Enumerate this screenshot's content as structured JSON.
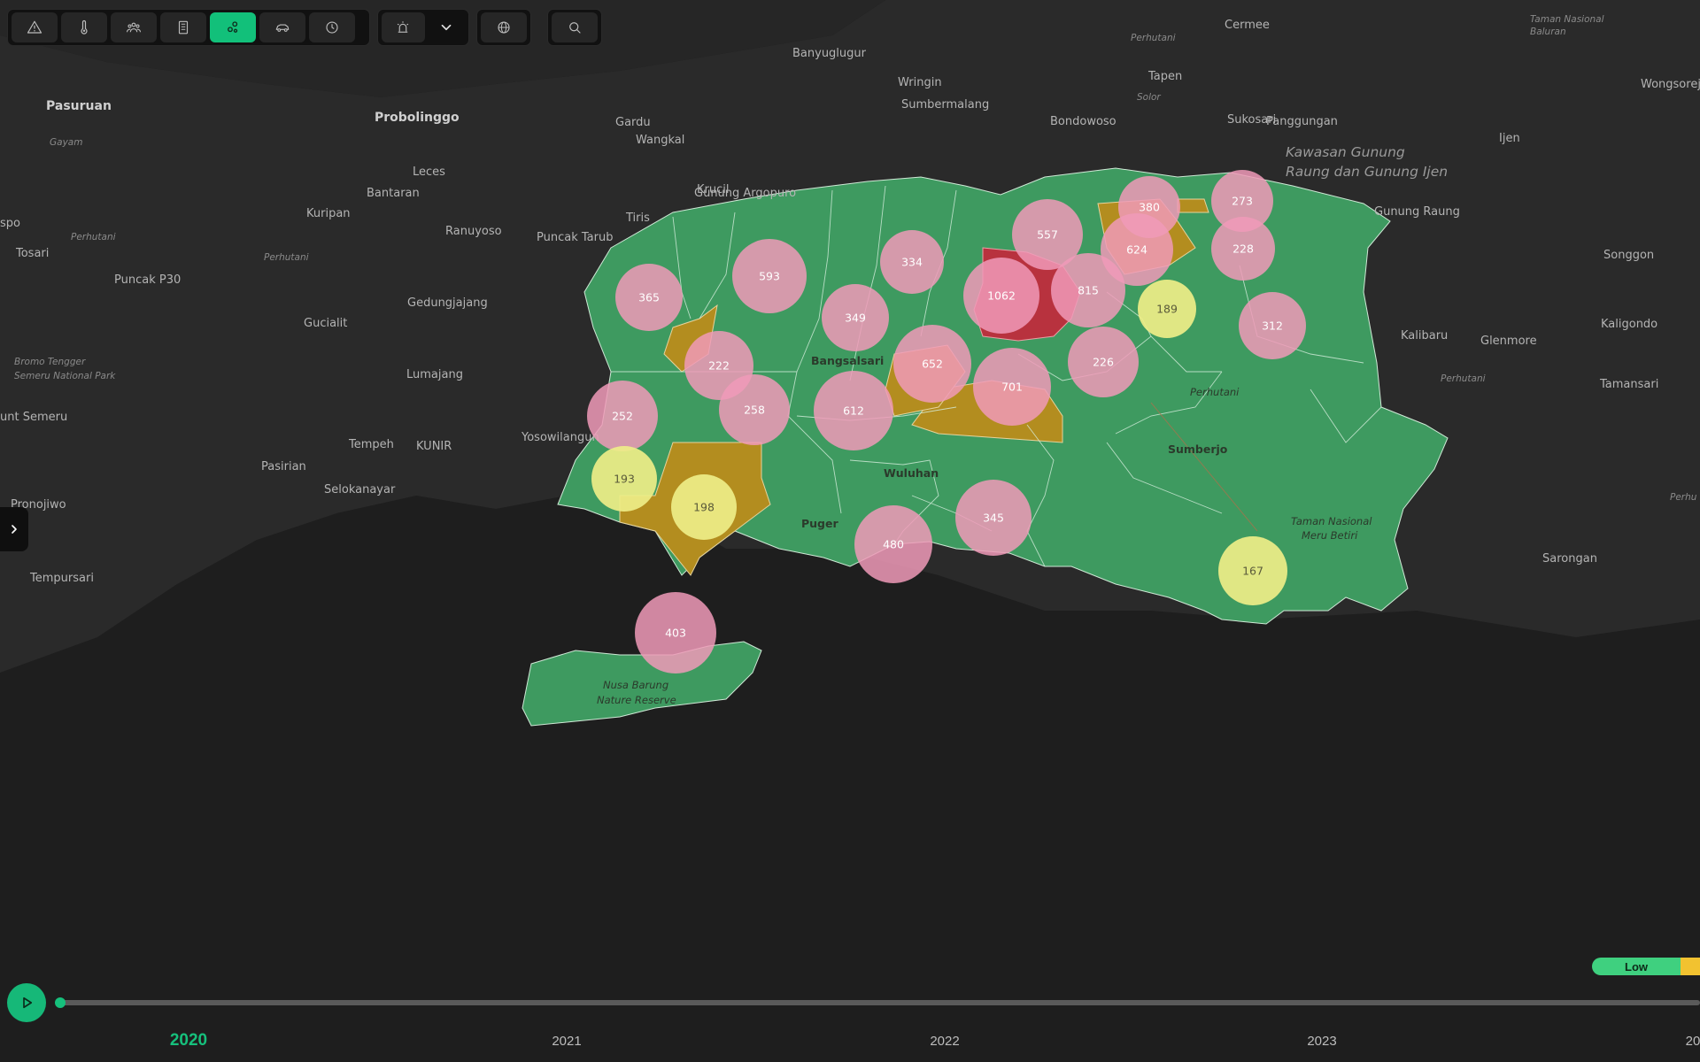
{
  "toolbar": {
    "group1": [
      {
        "icon": "warning-icon",
        "active": false
      },
      {
        "icon": "thermometer-icon",
        "active": false
      },
      {
        "icon": "people-icon",
        "active": false
      },
      {
        "icon": "building-icon",
        "active": false
      },
      {
        "icon": "cluster-icon",
        "active": true
      },
      {
        "icon": "car-icon",
        "active": false
      },
      {
        "icon": "clock-icon",
        "active": false
      }
    ],
    "group2": [
      {
        "icon": "siren-icon"
      },
      {
        "icon": "chevron-down-icon"
      }
    ],
    "group3": [
      {
        "icon": "globe-icon"
      }
    ],
    "group4": [
      {
        "icon": "search-icon"
      }
    ]
  },
  "colors": {
    "accent": "#12c07a",
    "region_low": "#3e9a60",
    "region_medium": "#b38d1f",
    "region_high": "#b8323e",
    "bubble_pink": "#f09ab8",
    "bubble_yellow": "#eeee88"
  },
  "places": [
    {
      "name": "Pasuruan",
      "style": "big"
    },
    {
      "name": "Probolinggo",
      "style": "big"
    },
    {
      "name": "Banyuglugur",
      "style": "normal"
    },
    {
      "name": "Perhutani",
      "style": "small"
    },
    {
      "name": "Cermee",
      "style": "normal"
    },
    {
      "name": "Taman Nasional",
      "style": "small"
    },
    {
      "name": "Baluran",
      "style": "small"
    },
    {
      "name": "Wongsorejo",
      "style": "normal"
    },
    {
      "name": "Tapen",
      "style": "normal"
    },
    {
      "name": "Wringin",
      "style": "normal"
    },
    {
      "name": "Sumbermalang",
      "style": "normal"
    },
    {
      "name": "Gardu",
      "style": "normal"
    },
    {
      "name": "Wangkal",
      "style": "normal"
    },
    {
      "name": "Bondowoso",
      "style": "normal"
    },
    {
      "name": "Sukosari",
      "style": "normal"
    },
    {
      "name": "Solor",
      "style": "small"
    },
    {
      "name": "Panggungan",
      "style": "normal"
    },
    {
      "name": "Ijen",
      "style": "normal"
    },
    {
      "name": "Kawasan Gunung",
      "style": "region"
    },
    {
      "name": "Raung dan Gunung Ijen",
      "style": "region"
    },
    {
      "name": "Gayam",
      "style": "small"
    },
    {
      "name": "Leces",
      "style": "normal"
    },
    {
      "name": "Bantaran",
      "style": "normal"
    },
    {
      "name": "Krucil",
      "style": "normal"
    },
    {
      "name": "Gunung Argopuro",
      "style": "normal"
    },
    {
      "name": "Kuripan",
      "style": "normal"
    },
    {
      "name": "Tiris",
      "style": "normal"
    },
    {
      "name": "Gunung Raung",
      "style": "normal"
    },
    {
      "name": "spo",
      "style": "normal"
    },
    {
      "name": "Perhutani",
      "style": "small"
    },
    {
      "name": "Perhutani",
      "style": "small"
    },
    {
      "name": "Ranuyoso",
      "style": "normal"
    },
    {
      "name": "Puncak Tarub",
      "style": "normal"
    },
    {
      "name": "Tosari",
      "style": "normal"
    },
    {
      "name": "Songgon",
      "style": "normal"
    },
    {
      "name": "Puncak P30",
      "style": "normal"
    },
    {
      "name": "Gedungjajang",
      "style": "normal"
    },
    {
      "name": "Gucialit",
      "style": "normal"
    },
    {
      "name": "Kalibaru",
      "style": "normal"
    },
    {
      "name": "Glenmore",
      "style": "normal"
    },
    {
      "name": "Kaligondo",
      "style": "normal"
    },
    {
      "name": "Bromo Tengger",
      "style": "small"
    },
    {
      "name": "Semeru National Park",
      "style": "small"
    },
    {
      "name": "Lumajang",
      "style": "normal"
    },
    {
      "name": "Perhutani",
      "style": "small"
    },
    {
      "name": "Tamansari",
      "style": "normal"
    },
    {
      "name": "unt Semeru",
      "style": "normal"
    },
    {
      "name": "Yosowilangun",
      "style": "normal"
    },
    {
      "name": "Tempeh",
      "style": "normal"
    },
    {
      "name": "KUNIR",
      "style": "normal"
    },
    {
      "name": "Pasirian",
      "style": "normal"
    },
    {
      "name": "Selokanayar",
      "style": "normal"
    },
    {
      "name": "Pronojiwo",
      "style": "normal"
    },
    {
      "name": "Sarongan",
      "style": "normal"
    },
    {
      "name": "Perhu",
      "style": "small"
    },
    {
      "name": "Tempursari",
      "style": "normal"
    },
    {
      "name": "Bangsalsari",
      "style": "onmap"
    },
    {
      "name": "Wuluhan",
      "style": "onmap"
    },
    {
      "name": "Puger",
      "style": "onmap"
    },
    {
      "name": "Sumberjo",
      "style": "onmap"
    },
    {
      "name": "Perhutani",
      "style": "onmap-it"
    },
    {
      "name": "Taman Nasional",
      "style": "onmap-it"
    },
    {
      "name": "Meru Betiri",
      "style": "onmap-it"
    },
    {
      "name": "Nusa Barung",
      "style": "onmap-it"
    },
    {
      "name": "Nature Reserve",
      "style": "onmap-it"
    }
  ],
  "bubbles": [
    {
      "value": "557",
      "level": "pink"
    },
    {
      "value": "380",
      "level": "pink"
    },
    {
      "value": "273",
      "level": "pink"
    },
    {
      "value": "624",
      "level": "pink"
    },
    {
      "value": "228",
      "level": "pink"
    },
    {
      "value": "593",
      "level": "pink"
    },
    {
      "value": "334",
      "level": "pink"
    },
    {
      "value": "365",
      "level": "pink"
    },
    {
      "value": "1062",
      "level": "pink"
    },
    {
      "value": "815",
      "level": "pink"
    },
    {
      "value": "189",
      "level": "yellow"
    },
    {
      "value": "349",
      "level": "pink"
    },
    {
      "value": "312",
      "level": "pink"
    },
    {
      "value": "222",
      "level": "pink"
    },
    {
      "value": "652",
      "level": "pink"
    },
    {
      "value": "226",
      "level": "pink"
    },
    {
      "value": "701",
      "level": "pink"
    },
    {
      "value": "252",
      "level": "pink"
    },
    {
      "value": "258",
      "level": "pink"
    },
    {
      "value": "612",
      "level": "pink"
    },
    {
      "value": "193",
      "level": "yellow"
    },
    {
      "value": "198",
      "level": "yellow"
    },
    {
      "value": "345",
      "level": "pink"
    },
    {
      "value": "480",
      "level": "pink"
    },
    {
      "value": "167",
      "level": "yellow"
    },
    {
      "value": "403",
      "level": "pink"
    }
  ],
  "legend": {
    "low_label": "Low"
  },
  "timeline": {
    "play_icon": "play-icon",
    "progress": 0.0,
    "years": [
      {
        "label": "2020",
        "active": true
      },
      {
        "label": "2021",
        "active": false
      },
      {
        "label": "2022",
        "active": false
      },
      {
        "label": "2023",
        "active": false
      },
      {
        "label": "20",
        "active": false
      }
    ]
  }
}
